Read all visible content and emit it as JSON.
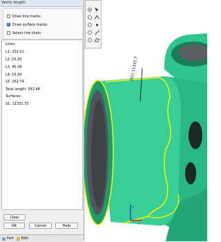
{
  "panel": {
    "title": "Verify length",
    "options": [
      {
        "label": "Draw line marks",
        "checked": false
      },
      {
        "label": "Draw surface marks",
        "checked": true
      },
      {
        "label": "Select line chain",
        "checked": false
      }
    ],
    "results": {
      "lines_header": "Lines:",
      "lines": [
        "L1: 232.01",
        "L2: 15.93",
        "L3: 45.06",
        "L4: 15.93",
        "L5: 262.74"
      ],
      "total": "Total length: 552.48",
      "surfaces_header": "Surfaces:",
      "surfaces": [
        "S1: 11331.72"
      ]
    },
    "buttons": {
      "clear": "Clear",
      "ok": "OK",
      "cancel": "Cancel",
      "help": "Help"
    },
    "bottom_tabs": [
      "Part",
      "Edit"
    ]
  },
  "viewport": {
    "dimension_label": "(S1) 11331.7",
    "axes": {
      "x": "x",
      "z": "z"
    },
    "colors": {
      "model": "#2ec58e",
      "model_dark": "#0f6a47",
      "bore": "#555a5e",
      "highlight": "#f2f200"
    }
  }
}
